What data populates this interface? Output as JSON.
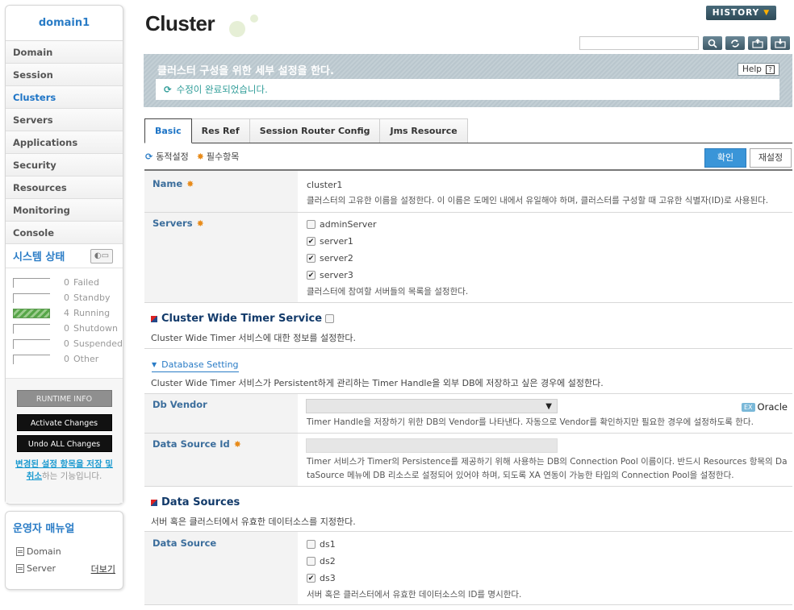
{
  "sidebar": {
    "domain": "domain1",
    "nav": [
      "Domain",
      "Session",
      "Clusters",
      "Servers",
      "Applications",
      "Security",
      "Resources",
      "Monitoring",
      "Console"
    ],
    "status_title": "시스템 상태",
    "statuses": [
      {
        "count": "0",
        "label": "Failed"
      },
      {
        "count": "0",
        "label": "Standby"
      },
      {
        "count": "4",
        "label": "Running"
      },
      {
        "count": "0",
        "label": "Shutdown"
      },
      {
        "count": "0",
        "label": "Suspended"
      },
      {
        "count": "0",
        "label": "Other"
      }
    ],
    "runtime_info": "RUNTIME INFO",
    "activate_changes": "Activate Changes",
    "undo_changes": "Undo ALL Changes",
    "note_link": "변경된 설정 항목을 저장 및 취소",
    "note_rest": "하는 기능입니다.",
    "manual_title": "운영자 매뉴얼",
    "manual_items": [
      "Domain",
      "Server"
    ],
    "more": "더보기"
  },
  "header": {
    "title": "Cluster",
    "history": "HISTORY",
    "history_arrow": "▼",
    "tool_icons": [
      "search-icon",
      "refresh-icon",
      "export-icon",
      "import-icon"
    ]
  },
  "banner": {
    "title": "클러스터 구성을 위한 세부 설정을 한다.",
    "help": "Help",
    "help_mark": "?",
    "message": "수정이 완료되었습니다."
  },
  "tabs": [
    "Basic",
    "Res Ref",
    "Session Router Config",
    "Jms Resource"
  ],
  "legend": {
    "dynamic": "동적설정",
    "required": "필수항목"
  },
  "actions": {
    "confirm": "확인",
    "reset": "재설정"
  },
  "form": {
    "name": {
      "label": "Name",
      "value": "cluster1",
      "desc": "클러스터의 고유한 이름을 설정한다. 이 이름은 도메인 내에서 유일해야 하며, 클러스터를 구성할 때 고유한 식별자(ID)로 사용된다."
    },
    "servers": {
      "label": "Servers",
      "options": [
        {
          "label": "adminServer",
          "checked": false
        },
        {
          "label": "server1",
          "checked": true
        },
        {
          "label": "server2",
          "checked": true
        },
        {
          "label": "server3",
          "checked": true
        }
      ],
      "desc": "클러스터에 참여할 서버들의 목록을 설정한다."
    },
    "timer": {
      "title": "Cluster Wide Timer Service",
      "checked": false,
      "desc": "Cluster Wide Timer 서비스에 대한 정보를 설정한다."
    },
    "db_setting": {
      "title": "Database Setting",
      "desc": "Cluster Wide Timer 서비스가 Persistent하게 관리하는 Timer Handle을 외부 DB에 저장하고 싶은 경우에 설정한다."
    },
    "db_vendor": {
      "label": "Db Vendor",
      "value": "",
      "ex_badge": "EX",
      "example": "Oracle",
      "desc": "Timer Handle을 저장하기 위한 DB의 Vendor를 나타낸다. 자동으로 Vendor를 확인하지만 필요한 경우에 설정하도록 한다."
    },
    "data_source_id": {
      "label": "Data Source Id",
      "value": "",
      "desc1": "Timer 서비스가 Timer의 Persistence를 제공하기 위해 사용하는 DB의 Connection Pool 이름이다. 반드시 Resources 항목의 Da",
      "desc2": "taSource 메뉴에 DB 리소스로 설정되어 있어야 하며, 되도록 XA 연동이 가능한 타입의 Connection Pool을 설정한다."
    },
    "data_sources_section": {
      "title": "Data Sources",
      "desc": "서버 혹은 클러스터에서 유효한 데이터소스를 지정한다."
    },
    "data_source": {
      "label": "Data Source",
      "options": [
        {
          "label": "ds1",
          "checked": false
        },
        {
          "label": "ds2",
          "checked": false
        },
        {
          "label": "ds3",
          "checked": true
        }
      ],
      "desc": "서버 혹은 클러스터에서 유효한 데이터소스의 ID를 명시한다."
    }
  }
}
